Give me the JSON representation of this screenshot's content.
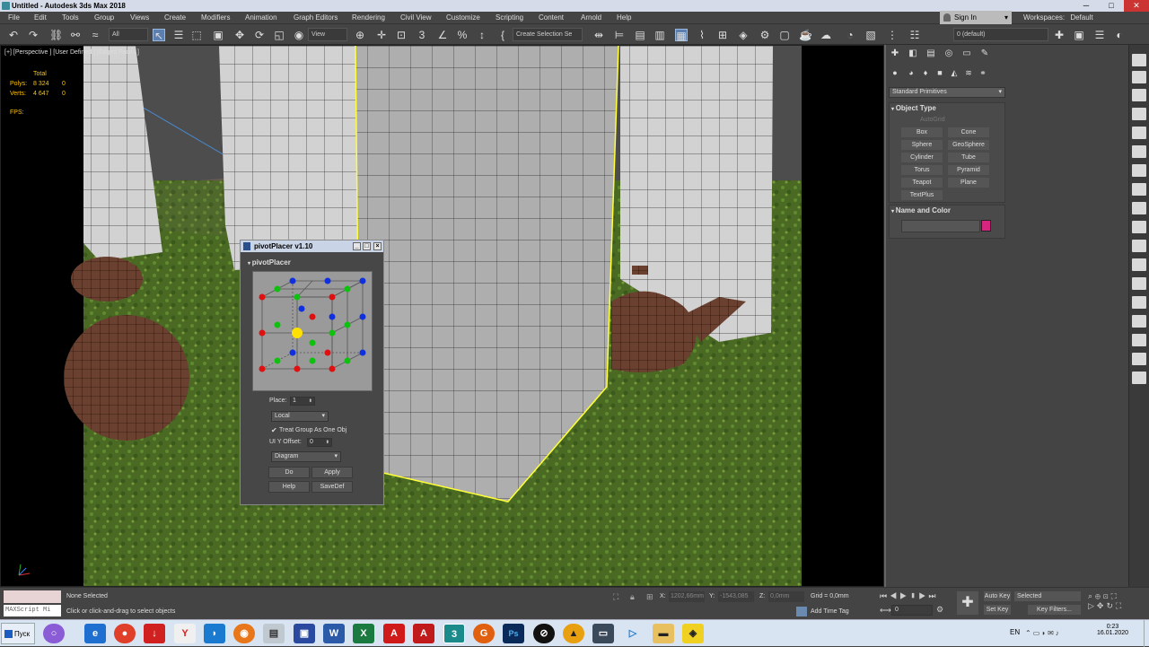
{
  "window": {
    "title": "Untitled - Autodesk 3ds Max 2018",
    "min": "─",
    "max": "□",
    "close": "✕"
  },
  "menu": [
    "File",
    "Edit",
    "Tools",
    "Group",
    "Views",
    "Create",
    "Modifiers",
    "Animation",
    "Graph Editors",
    "Rendering",
    "Civil View",
    "Customize",
    "Scripting",
    "Content",
    "Arnold",
    "Help"
  ],
  "signin": {
    "label": "Sign In",
    "arrow": "▾"
  },
  "workspaces": {
    "label": "Workspaces:",
    "value": "Default"
  },
  "toolbar": {
    "selection_filter": "All",
    "ref_coord": "View",
    "selection_set": "Create Selection Se",
    "layer": "0 (default)"
  },
  "viewport": {
    "label": "[+] [Perspective ] [User Defined ] [Edged Faces ]",
    "stats": {
      "total": "Total",
      "polys_label": "Polys:",
      "polys_total": "8 324",
      "polys_sel": "0",
      "verts_label": "Verts:",
      "verts_total": "4 647",
      "verts_sel": "0",
      "fps_label": "FPS:"
    }
  },
  "dialog": {
    "title": "pivotPlacer v1.10",
    "rollout": "pivotPlacer",
    "place_label": "Place:",
    "place_value": "1",
    "coord_mode": "Local",
    "treat_group": "Treat Group As One Obj",
    "ui_y_offset_label": "UI Y Offset:",
    "ui_y_offset_value": "0",
    "view_mode": "Diagram",
    "btn_do": "Do",
    "btn_apply": "Apply",
    "btn_help": "Help",
    "btn_savedef": "SaveDef"
  },
  "command_panel": {
    "category": "Standard Primitives",
    "object_type": "Object Type",
    "autogrid": "AutoGrid",
    "primitives": [
      "Box",
      "Cone",
      "Sphere",
      "GeoSphere",
      "Cylinder",
      "Tube",
      "Torus",
      "Pyramid",
      "Teapot",
      "Plane",
      "TextPlus"
    ],
    "name_and_color": "Name and Color",
    "color": "#d4267f"
  },
  "statusbar": {
    "maxscript": "MAXScript Mi",
    "status1": "None Selected",
    "status2": "Click or click-and-drag to select objects",
    "x_label": "X:",
    "x_value": "1202,66mm",
    "y_label": "Y:",
    "y_value": "-1543,085",
    "z_label": "Z:",
    "z_value": "0,0mm",
    "grid": "Grid = 0,0mm",
    "add_time_tag": "Add Time Tag",
    "auto_key": "Auto Key",
    "set_key": "Set Key",
    "selected": "Selected",
    "key_filters": "Key Filters...",
    "frame": "0"
  },
  "taskbar": {
    "start": "Пуск",
    "lang": "EN",
    "time": "0:23",
    "date": "16.01.2020"
  }
}
